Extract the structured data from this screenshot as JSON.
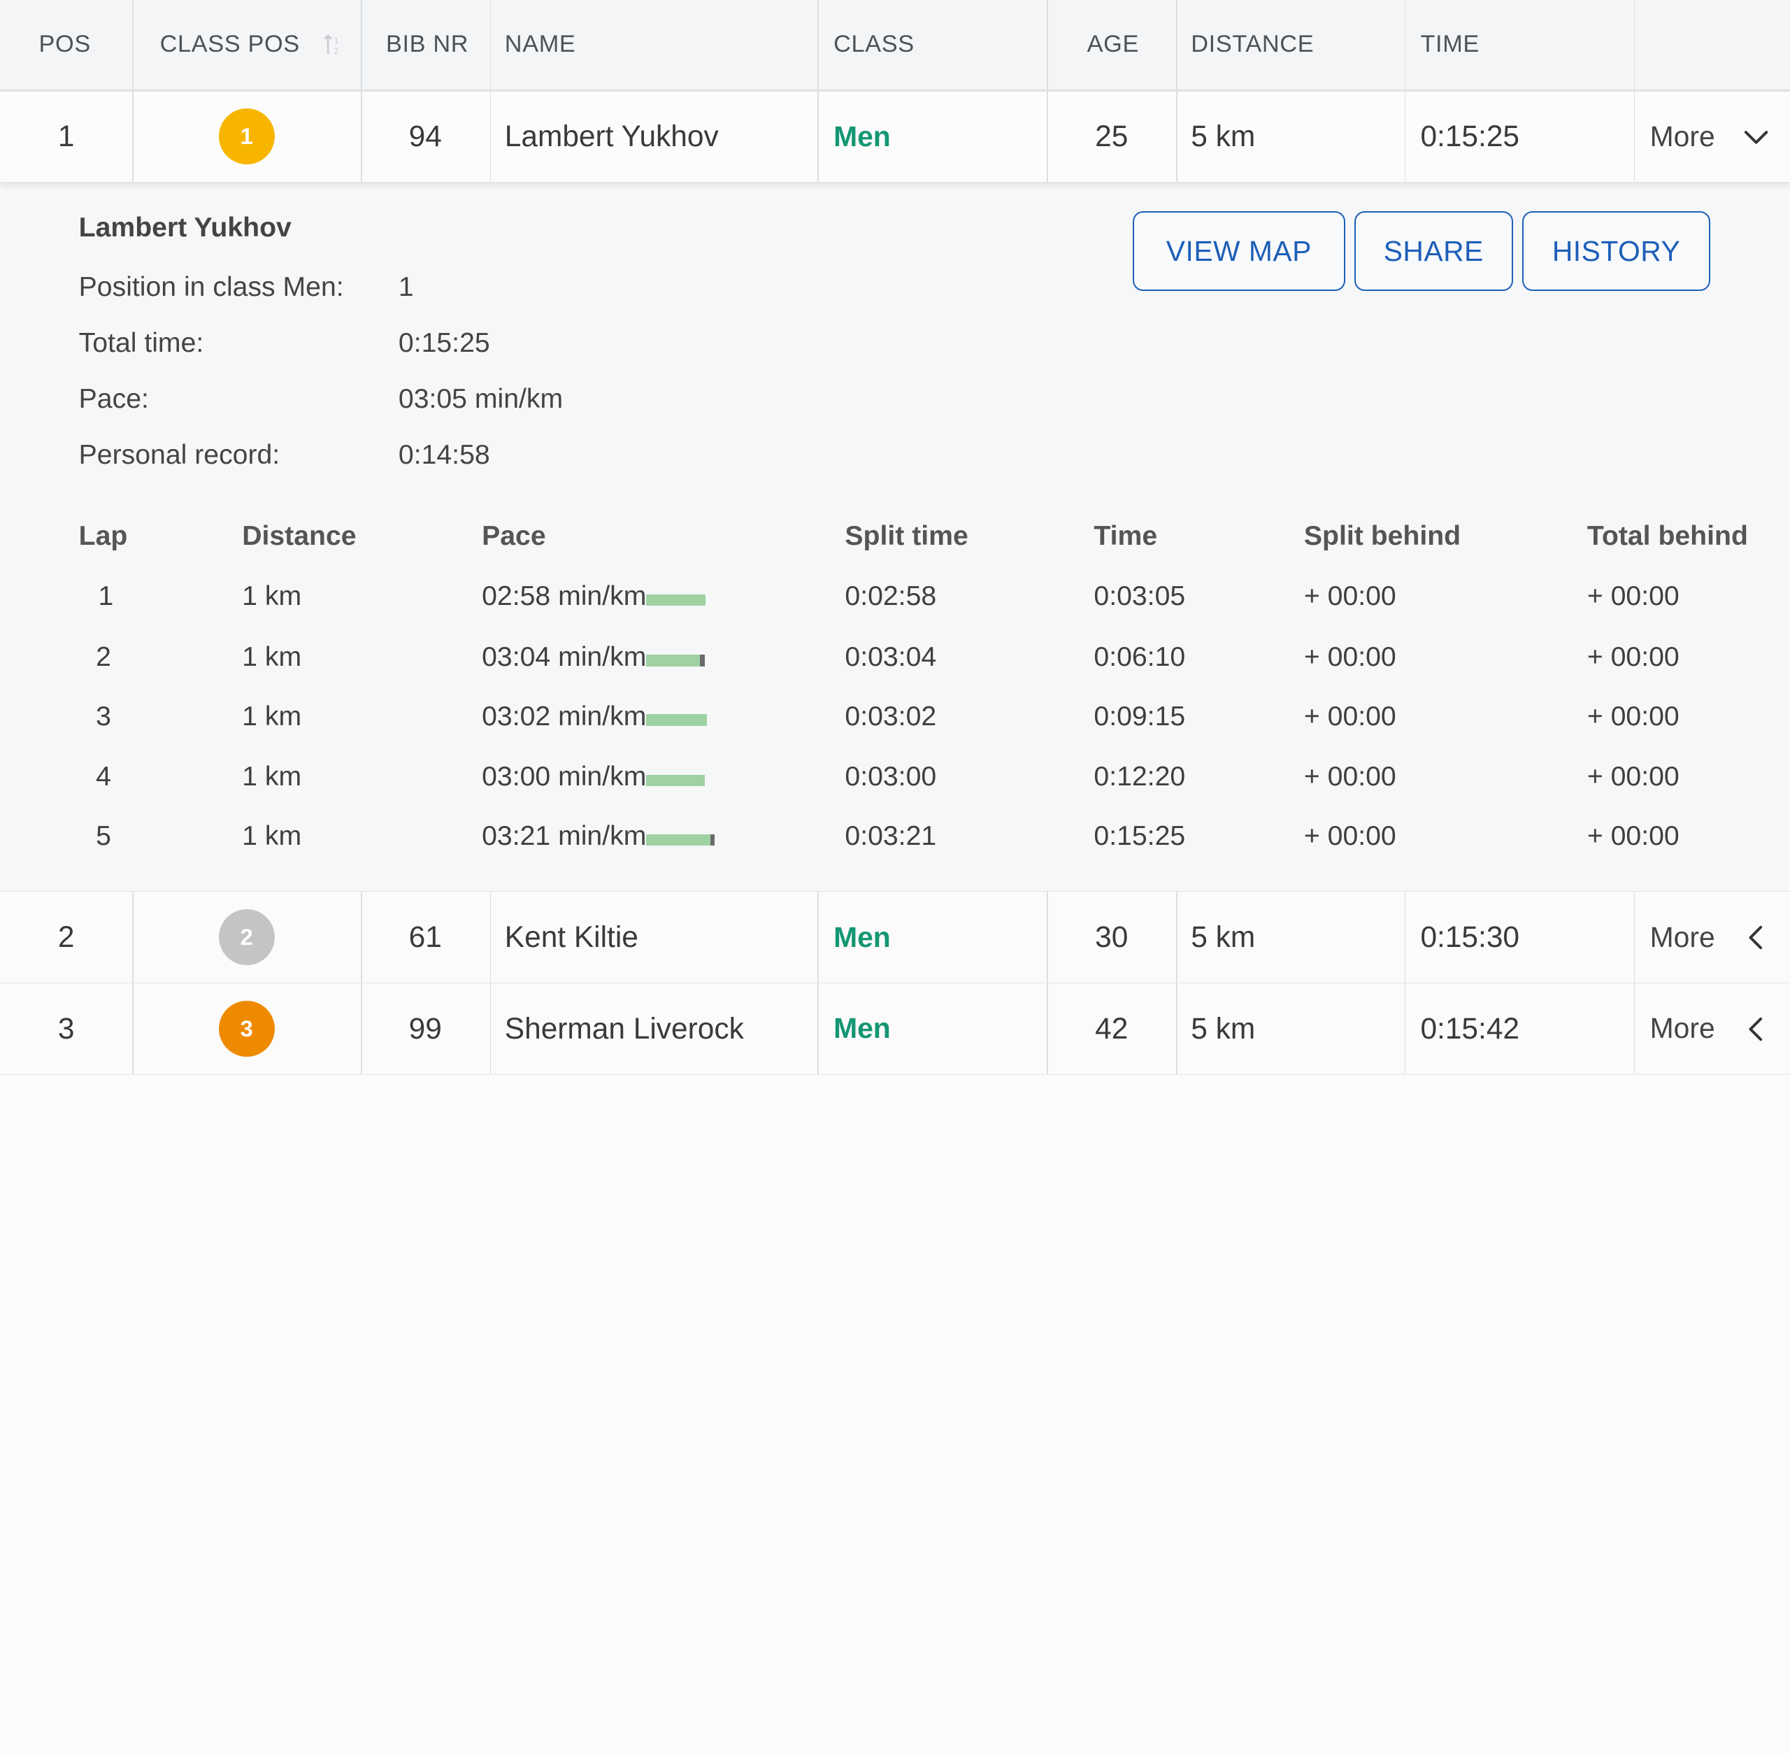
{
  "header": {
    "pos": "POS",
    "class_pos": "CLASS POS",
    "bib": "BIB NR",
    "name": "NAME",
    "class": "CLASS",
    "age": "AGE",
    "distance": "DISTANCE",
    "time": "TIME"
  },
  "rows": [
    {
      "pos": "1",
      "class_pos": "1",
      "bib": "94",
      "name": "Lambert Yukhov",
      "class": "Men",
      "age": "25",
      "distance": "5 km",
      "time": "0:15:25",
      "more": "More",
      "medal_color": "#f7b500"
    },
    {
      "pos": "2",
      "class_pos": "2",
      "bib": "61",
      "name": "Kent Kiltie",
      "class": "Men",
      "age": "30",
      "distance": "5 km",
      "time": "0:15:30",
      "more": "More",
      "medal_color": "#c4c4c4"
    },
    {
      "pos": "3",
      "class_pos": "3",
      "bib": "99",
      "name": "Sherman Liverock",
      "class": "Men",
      "age": "42",
      "distance": "5 km",
      "time": "0:15:42",
      "more": "More",
      "medal_color": "#ee8a00"
    }
  ],
  "details": {
    "name": "Lambert Yukhov",
    "fields": [
      {
        "label": "Position in class Men:",
        "value": "1"
      },
      {
        "label": "Total time:",
        "value": "0:15:25"
      },
      {
        "label": "Pace:",
        "value": "03:05 min/km"
      },
      {
        "label": "Personal record:",
        "value": "0:14:58"
      }
    ],
    "buttons": {
      "view_map": "VIEW MAP",
      "share": "SHARE",
      "history": "HISTORY"
    },
    "laps_header": {
      "lap": "Lap",
      "distance": "Distance",
      "pace": "Pace",
      "split_time": "Split time",
      "time": "Time",
      "split_behind": "Split behind",
      "total_behind": "Total behind"
    },
    "laps": [
      {
        "lap": "1",
        "distance": "1 km",
        "pace": "02:58 min/km",
        "split_time": "0:02:58",
        "time": "0:03:05",
        "split_behind": "+ 00:00",
        "total_behind": "+ 00:00"
      },
      {
        "lap": "2",
        "distance": "1 km",
        "pace": "03:04 min/km",
        "split_time": "0:03:04",
        "time": "0:06:10",
        "split_behind": "+ 00:00",
        "total_behind": "+ 00:00"
      },
      {
        "lap": "3",
        "distance": "1 km",
        "pace": "03:02 min/km",
        "split_time": "0:03:02",
        "time": "0:09:15",
        "split_behind": "+ 00:00",
        "total_behind": "+ 00:00"
      },
      {
        "lap": "4",
        "distance": "1 km",
        "pace": "03:00 min/km",
        "split_time": "0:03:00",
        "time": "0:12:20",
        "split_behind": "+ 00:00",
        "total_behind": "+ 00:00"
      },
      {
        "lap": "5",
        "distance": "1 km",
        "pace": "03:21 min/km",
        "split_time": "0:03:21",
        "time": "0:15:25",
        "split_behind": "+ 00:00",
        "total_behind": "+ 00:00"
      }
    ]
  },
  "colors": {
    "accent": "#1d5fb8",
    "class_green": "#149673",
    "pace_bar": "#9fd1a3"
  }
}
